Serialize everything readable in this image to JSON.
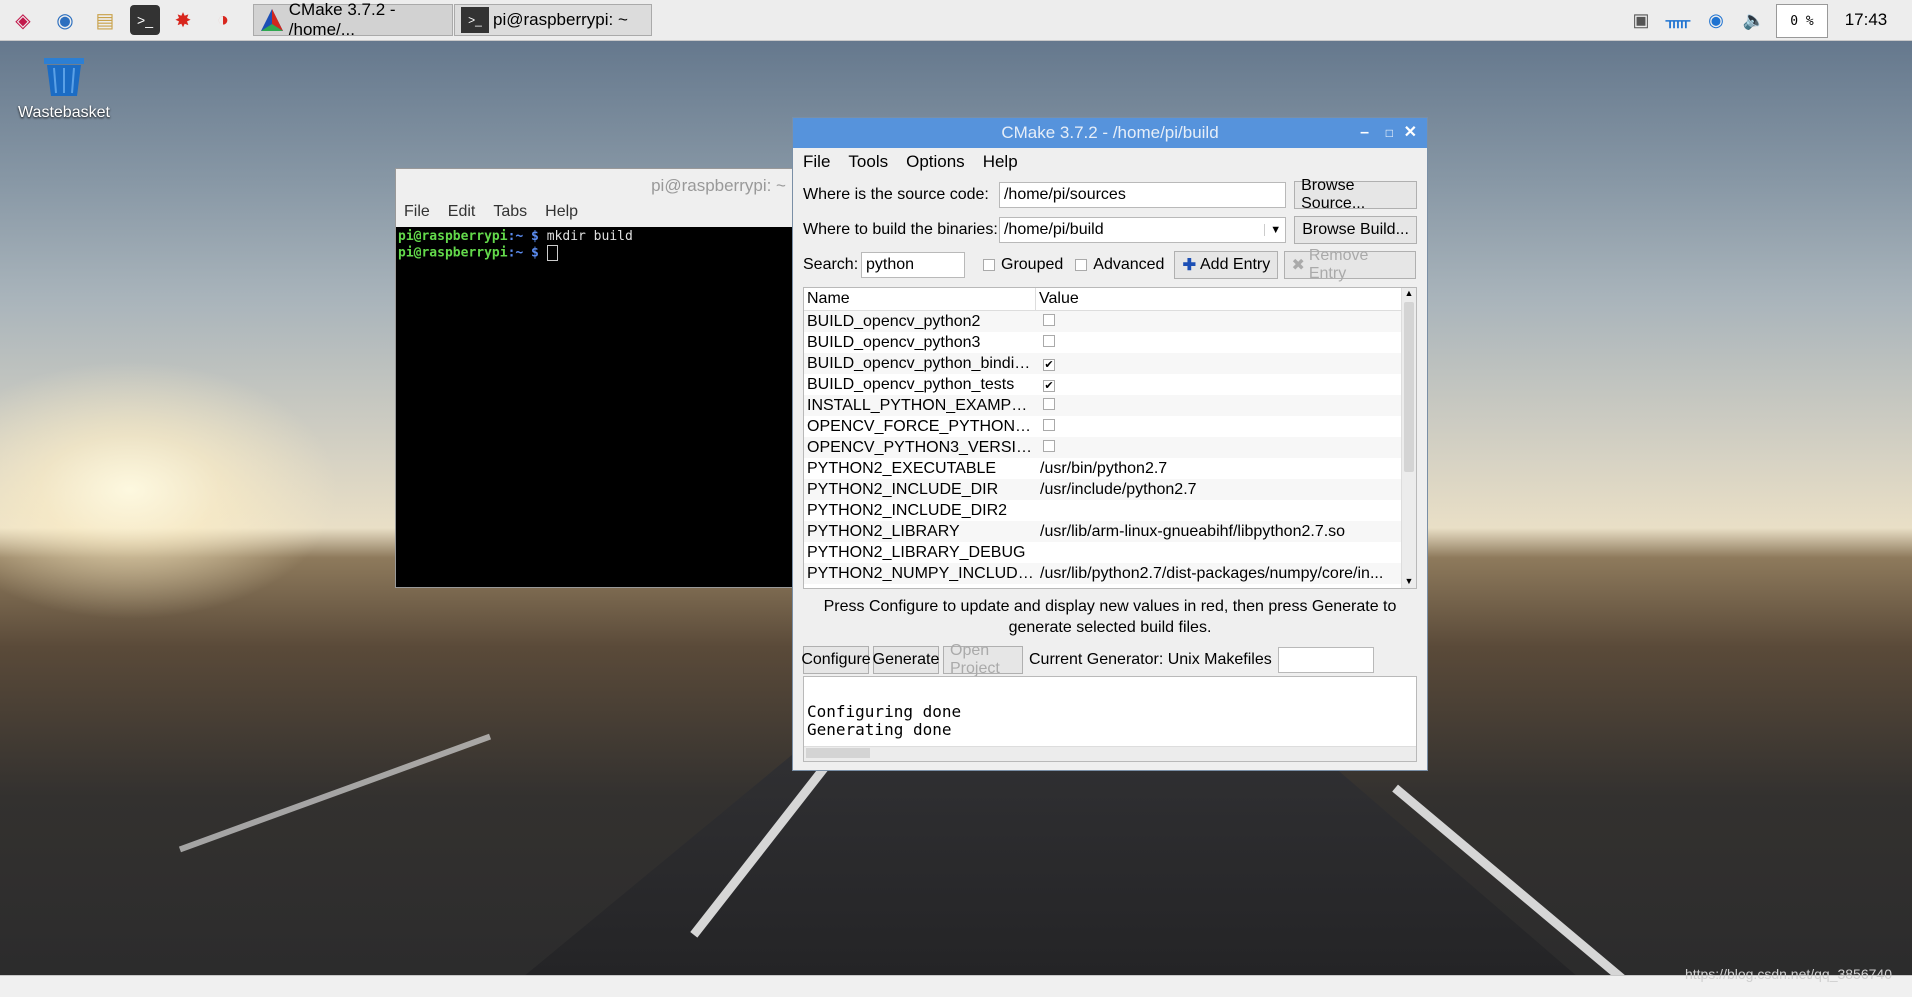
{
  "taskbar": {
    "launchers": [
      "raspberry-menu-icon",
      "browser-icon",
      "file-manager-icon",
      "terminal-icon",
      "math-icon",
      "wolfram-icon"
    ],
    "tasks": [
      {
        "label": "CMake 3.7.2 - /home/...",
        "icon": "cmake-icon"
      },
      {
        "label": "pi@raspberrypi: ~",
        "icon": "terminal-icon"
      }
    ],
    "cpu": "0 %",
    "clock": "17:43"
  },
  "desktop": {
    "wastebasket_label": "Wastebasket",
    "watermark": "https://blog.csdn.net/qq_3856740"
  },
  "terminal": {
    "title": "pi@raspberrypi: ~",
    "menu": [
      "File",
      "Edit",
      "Tabs",
      "Help"
    ],
    "lines": [
      {
        "user": "pi@raspberrypi",
        "path": ":~",
        "prompt": " $",
        "cmd": " mkdir build"
      },
      {
        "user": "pi@raspberrypi",
        "path": ":~",
        "prompt": " $",
        "cmd": " "
      }
    ]
  },
  "cmake": {
    "title": "CMake 3.7.2 - /home/pi/build",
    "menu": [
      "File",
      "Tools",
      "Options",
      "Help"
    ],
    "source_label": "Where is the source code:",
    "source_value": "/home/pi/sources",
    "browse_source": "Browse Source...",
    "build_label": "Where to build the binaries:",
    "build_value": "/home/pi/build",
    "browse_build": "Browse Build...",
    "search_label": "Search:",
    "search_value": "python",
    "grouped_label": "Grouped",
    "advanced_label": "Advanced",
    "add_entry": "Add Entry",
    "remove_entry": "Remove Entry",
    "col_name": "Name",
    "col_value": "Value",
    "rows": [
      {
        "name": "BUILD_opencv_python2",
        "value": "",
        "check": "off"
      },
      {
        "name": "BUILD_opencv_python3",
        "value": "",
        "check": "off"
      },
      {
        "name": "BUILD_opencv_python_bindin...",
        "value": "",
        "check": "on"
      },
      {
        "name": "BUILD_opencv_python_tests",
        "value": "",
        "check": "on"
      },
      {
        "name": "INSTALL_PYTHON_EXAMPLES",
        "value": "",
        "check": "off"
      },
      {
        "name": "OPENCV_FORCE_PYTHON_LIBS",
        "value": "",
        "check": "off"
      },
      {
        "name": "OPENCV_PYTHON3_VERSION",
        "value": "",
        "check": "off"
      },
      {
        "name": "PYTHON2_EXECUTABLE",
        "value": "/usr/bin/python2.7",
        "check": "none"
      },
      {
        "name": "PYTHON2_INCLUDE_DIR",
        "value": "/usr/include/python2.7",
        "check": "none"
      },
      {
        "name": "PYTHON2_INCLUDE_DIR2",
        "value": "",
        "check": "none"
      },
      {
        "name": "PYTHON2_LIBRARY",
        "value": "/usr/lib/arm-linux-gnueabihf/libpython2.7.so",
        "check": "none"
      },
      {
        "name": "PYTHON2_LIBRARY_DEBUG",
        "value": "",
        "check": "none"
      },
      {
        "name": "PYTHON2_NUMPY_INCLUDE_...",
        "value": "/usr/lib/python2.7/dist-packages/numpy/core/in...",
        "check": "none"
      }
    ],
    "note": "Press Configure to update and display new values in red, then press Generate to generate selected build files.",
    "configure": "Configure",
    "generate": "Generate",
    "open_project": "Open Project",
    "generator_label": "Current Generator: Unix Makefiles",
    "log": [
      "Configuring done",
      "Generating done"
    ]
  },
  "colors": {
    "titlebar": "#5693dc",
    "terminal_bg": "#000000",
    "prompt_user": "#63d94b",
    "prompt_path": "#5b8cf0"
  }
}
